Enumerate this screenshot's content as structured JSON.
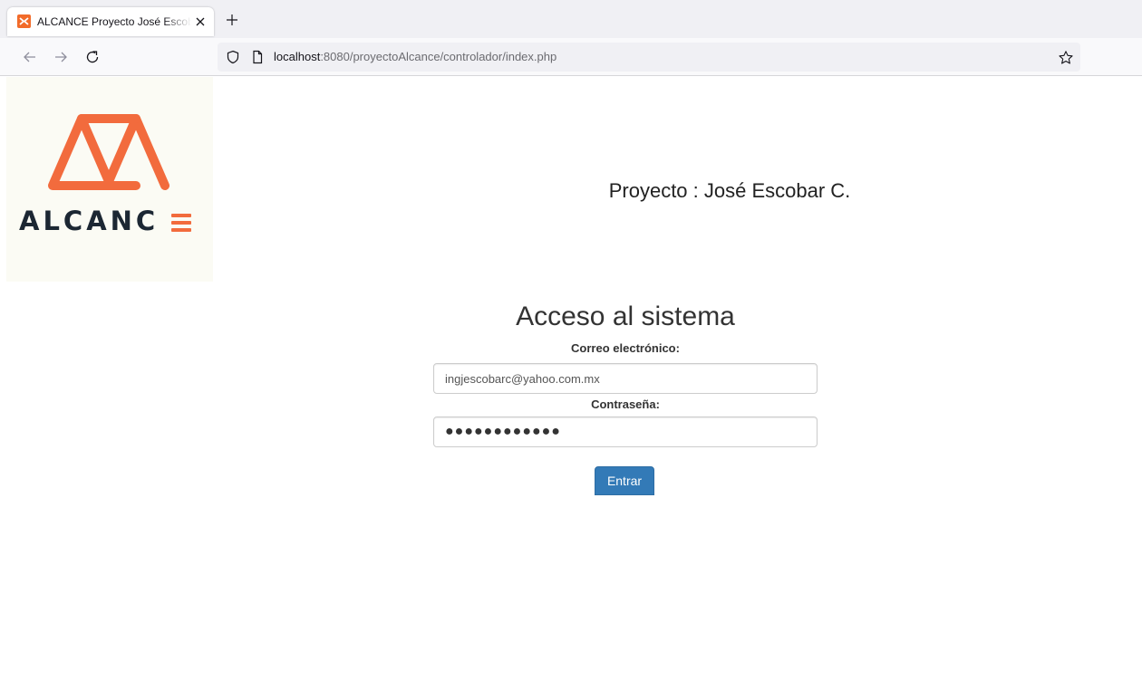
{
  "browser": {
    "tab": {
      "title": "ALCANCE Proyecto José Escobar C.",
      "favicon": "xampp-icon",
      "close_icon": "close-icon"
    },
    "new_tab_icon": "plus-icon",
    "nav": {
      "back_icon": "arrow-left-icon",
      "forward_icon": "arrow-right-icon",
      "reload_icon": "reload-icon"
    },
    "url": {
      "host": "localhost",
      "path": ":8080/proyectoAlcance/controlador/index.php",
      "shield_icon": "shield-icon",
      "page_icon": "page-icon",
      "bookmark_icon": "star-icon"
    }
  },
  "page": {
    "logo": {
      "text": "ALCANC",
      "full_text": "ALCANCE",
      "mark_icon": "alcance-mountain-logo",
      "accent_color": "#f26b3d",
      "text_color": "#1c2733"
    },
    "project_title": "Proyecto : José Escobar C.",
    "login": {
      "heading": "Acceso al sistema",
      "email_label": "Correo electrónico:",
      "email_value": "ingjescobarc@yahoo.com.mx",
      "password_label": "Contraseña:",
      "password_value": "●●●●●●●●●●●●",
      "submit_label": "Entrar",
      "submit_color": "#337ab7"
    }
  }
}
